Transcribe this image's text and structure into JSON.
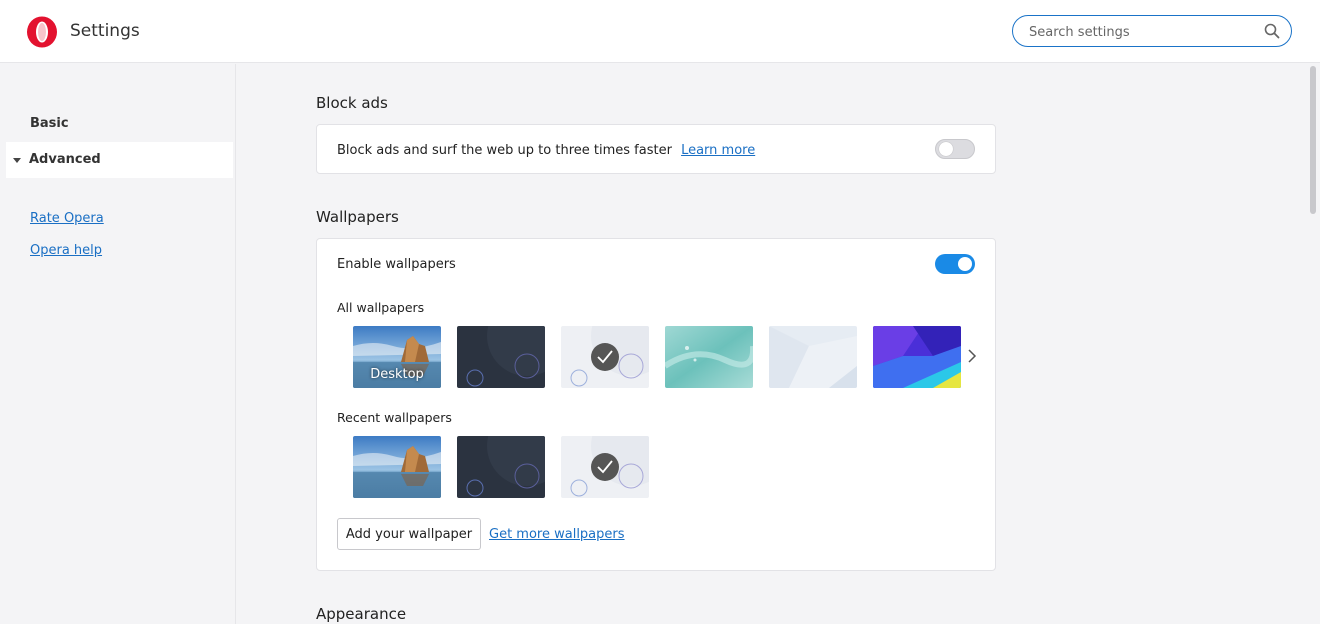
{
  "header": {
    "title": "Settings",
    "search_placeholder": "Search settings"
  },
  "sidebar": {
    "items": [
      {
        "label": "Basic"
      },
      {
        "label": "Advanced"
      }
    ],
    "links": [
      {
        "label": "Rate Opera"
      },
      {
        "label": "Opera help"
      }
    ]
  },
  "block_ads": {
    "title": "Block ads",
    "description": "Block ads and surf the web up to three times faster",
    "learn_more": "Learn more",
    "enabled": false
  },
  "wallpapers": {
    "title": "Wallpapers",
    "enable_label": "Enable wallpapers",
    "enabled": true,
    "all_label": "All wallpapers",
    "all": [
      {
        "id": "desktop",
        "label": "Desktop",
        "selected": false
      },
      {
        "id": "dark",
        "label": "",
        "selected": false
      },
      {
        "id": "light",
        "label": "",
        "selected": true
      },
      {
        "id": "teal",
        "label": "",
        "selected": false
      },
      {
        "id": "pale",
        "label": "",
        "selected": false
      },
      {
        "id": "purple",
        "label": "",
        "selected": false
      }
    ],
    "recent_label": "Recent wallpapers",
    "recent": [
      {
        "id": "desktop",
        "selected": false
      },
      {
        "id": "dark",
        "selected": false
      },
      {
        "id": "light",
        "selected": true
      }
    ],
    "add_button": "Add your wallpaper",
    "get_more": "Get more wallpapers"
  },
  "appearance": {
    "title": "Appearance"
  },
  "colors": {
    "accent": "#1a8ae6",
    "link": "#1a6fc4",
    "opera_red": "#e3122f"
  }
}
